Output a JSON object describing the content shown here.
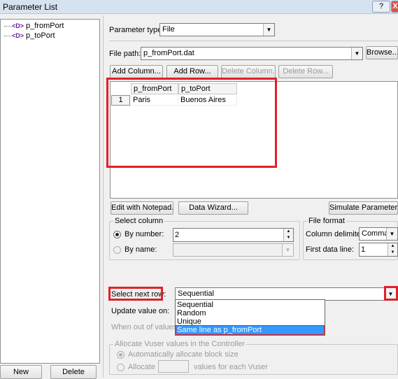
{
  "window": {
    "title": "Parameter List",
    "help_button": "?",
    "close_button": "X"
  },
  "tree": {
    "items": [
      {
        "icon": "<D>",
        "label": "p_fromPort"
      },
      {
        "icon": "<D>",
        "label": "p_toPort"
      }
    ]
  },
  "bottom_buttons": {
    "new": "New",
    "delete": "Delete"
  },
  "param_type": {
    "label": "Parameter type:",
    "value": "File"
  },
  "file_path": {
    "label": "File path:",
    "value": "p_fromPort.dat",
    "browse": "Browse..."
  },
  "grid_buttons": {
    "add_column": "Add Column...",
    "add_row": "Add Row...",
    "delete_column": "Delete Column...",
    "delete_row": "Delete Row..."
  },
  "table": {
    "columns": [
      "p_fromPort",
      "p_toPort"
    ],
    "rows": [
      {
        "num": "1",
        "cells": [
          "Paris",
          "Buenos Aires"
        ]
      }
    ]
  },
  "actions": {
    "edit_notepad": "Edit with Notepad...",
    "data_wizard": "Data Wizard...",
    "simulate": "Simulate Parameter..."
  },
  "select_column": {
    "title": "Select column",
    "by_number_label": "By number:",
    "by_number_value": "2",
    "by_name_label": "By name:"
  },
  "file_format": {
    "title": "File format",
    "delimiter_label": "Column delimiter:",
    "delimiter_value": "Comma",
    "first_line_label": "First data line:",
    "first_line_value": "1"
  },
  "next_row": {
    "label": "Select next row:",
    "value": "Sequential",
    "options": [
      "Sequential",
      "Random",
      "Unique",
      "Same line as p_fromPort"
    ]
  },
  "update_value": {
    "label": "Update value on:"
  },
  "out_of_values": {
    "label": "When out of values:"
  },
  "allocate": {
    "title": "Allocate Vuser values in the Controller",
    "auto_label": "Automatically allocate block size",
    "manual_label": "Allocate",
    "manual_suffix": "values for each Vuser"
  }
}
